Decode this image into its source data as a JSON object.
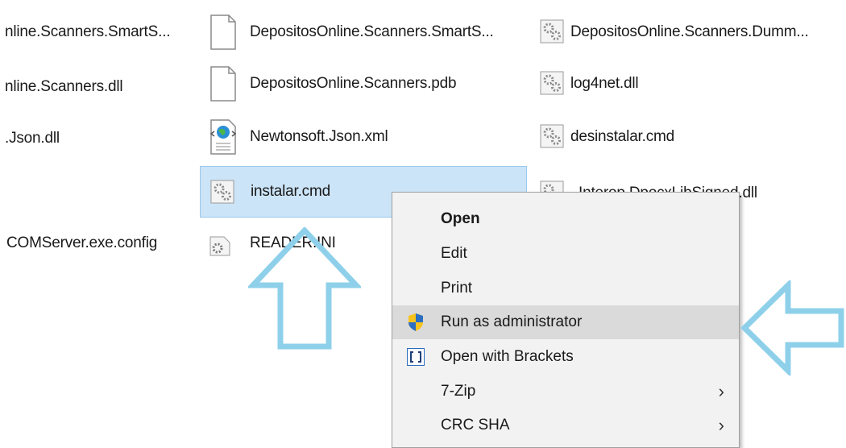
{
  "files": [
    {
      "id": "f1",
      "name": "nline.Scanners.SmartS..."
    },
    {
      "id": "f2",
      "name": "DepositosOnline.Scanners.SmartS..."
    },
    {
      "id": "f3",
      "name": "DepositosOnline.Scanners.Dumm..."
    },
    {
      "id": "f4",
      "name": "nline.Scanners.dll"
    },
    {
      "id": "f5",
      "name": "DepositosOnline.Scanners.pdb"
    },
    {
      "id": "f6",
      "name": "log4net.dll"
    },
    {
      "id": "f7",
      "name": ".Json.dll"
    },
    {
      "id": "f8",
      "name": "Newtonsoft.Json.xml"
    },
    {
      "id": "f9",
      "name": "desinstalar.cmd"
    },
    {
      "id": "f10",
      "name": "instalar.cmd"
    },
    {
      "id": "f11",
      "name": "Interop.DpocxLibSigned.dll"
    },
    {
      "id": "f12",
      "name": "COMServer.exe.config"
    },
    {
      "id": "f13",
      "name": "READER.INI"
    }
  ],
  "context_menu": {
    "items": [
      {
        "label": "Open",
        "icon": "",
        "submenu": false
      },
      {
        "label": "Edit",
        "icon": "",
        "submenu": false
      },
      {
        "label": "Print",
        "icon": "",
        "submenu": false
      },
      {
        "label": "Run as administrator",
        "icon": "uac-shield-icon",
        "submenu": false
      },
      {
        "label": "Open with Brackets",
        "icon": "brackets-icon",
        "submenu": false
      },
      {
        "label": "7-Zip",
        "icon": "",
        "submenu": true
      },
      {
        "label": "CRC SHA",
        "icon": "",
        "submenu": true
      }
    ],
    "submenu_glyph": "›"
  },
  "colors": {
    "selection_bg": "#cce4f7",
    "selection_border": "#99c9ef",
    "menu_bg": "#f2f2f2",
    "menu_highlight": "#dadada",
    "annotation_arrow": "#8ed0ea"
  }
}
